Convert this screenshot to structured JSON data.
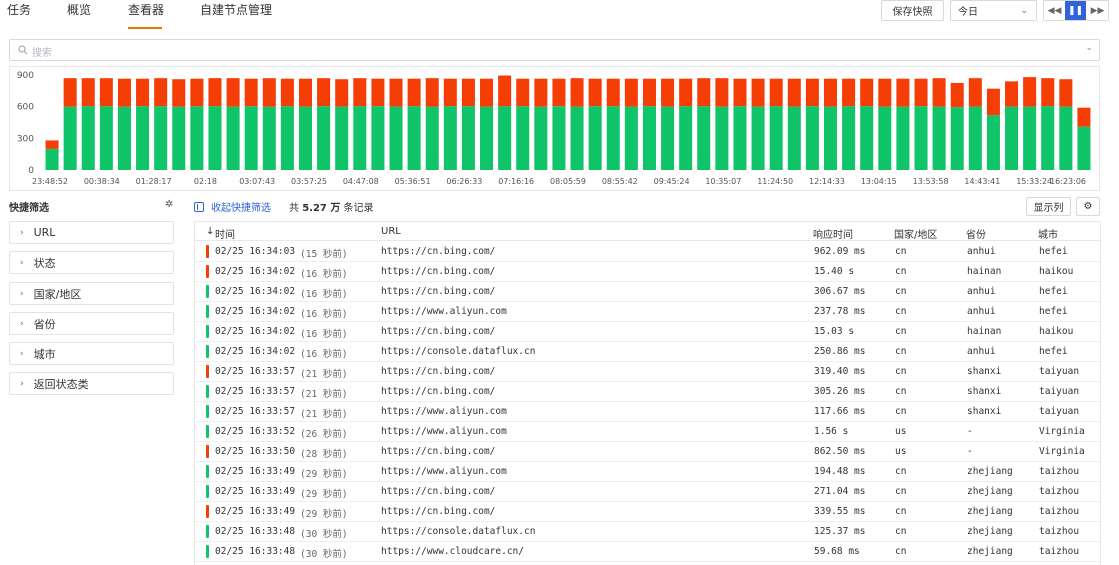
{
  "tabs": [
    {
      "label": "任务",
      "active": false
    },
    {
      "label": "概览",
      "active": false
    },
    {
      "label": "查看器",
      "active": true
    },
    {
      "label": "自建节点管理",
      "active": false
    }
  ],
  "toolbar": {
    "save_snapshot_label": "保存快照",
    "time_range_value": "今日",
    "play_controls": [
      "rewind-icon",
      "pause-icon",
      "forward-icon"
    ]
  },
  "search": {
    "placeholder": "搜索"
  },
  "colors": {
    "success": "#10c469",
    "error": "#f53e06",
    "accent": "#2f63d7",
    "tab_underline": "#e8750d"
  },
  "chart_data": {
    "type": "bar",
    "stacked": true,
    "ylim": [
      0,
      900
    ],
    "y_ticks": [
      "0",
      "300",
      "600",
      "900"
    ],
    "x_tick_labels": [
      "23:48:52",
      "00:38:34",
      "01:28:17",
      "02:18",
      "03:07:43",
      "03:57:25",
      "04:47:08",
      "05:36:51",
      "06:26:33",
      "07:16:16",
      "08:05:59",
      "08:55:42",
      "09:45:24",
      "10:35:07",
      "11:24:50",
      "12:14:33",
      "13:04:15",
      "13:53:58",
      "14:43:41",
      "15:33:24",
      "16:23:06"
    ],
    "series": [
      {
        "color": "#10c469",
        "values": [
          200,
          600,
          605,
          605,
          600,
          605,
          605,
          600,
          605,
          605,
          600,
          605,
          600,
          605,
          600,
          605,
          600,
          605,
          605,
          600,
          605,
          600,
          605,
          605,
          600,
          605,
          605,
          600,
          605,
          600,
          605,
          605,
          600,
          605,
          600,
          605,
          605,
          600,
          605,
          600,
          605,
          600,
          605,
          600,
          605,
          605,
          600,
          600,
          605,
          600,
          595,
          600,
          520,
          600,
          600,
          605,
          600,
          410
        ]
      },
      {
        "color": "#f53e06",
        "values": [
          80,
          270,
          265,
          265,
          265,
          260,
          265,
          260,
          260,
          265,
          270,
          260,
          270,
          260,
          265,
          265,
          260,
          265,
          260,
          265,
          260,
          270,
          260,
          260,
          265,
          290,
          260,
          265,
          260,
          270,
          260,
          260,
          265,
          260,
          265,
          260,
          265,
          270,
          260,
          265,
          260,
          265,
          260,
          265,
          260,
          260,
          265,
          265,
          260,
          270,
          230,
          270,
          250,
          240,
          280,
          265,
          260,
          180
        ]
      }
    ]
  },
  "sidebar": {
    "title": "快捷筛选",
    "facets": [
      "URL",
      "状态",
      "国家/地区",
      "省份",
      "城市",
      "返回状态类"
    ]
  },
  "list": {
    "collapse_label": "收起快捷筛选",
    "count_prefix": "共",
    "count_value": "5.27 万",
    "count_suffix": "条记录",
    "show_columns_label": "显示列",
    "columns": [
      "时间",
      "URL",
      "响应时间",
      "国家/地区",
      "省份",
      "城市"
    ],
    "rows": [
      {
        "status": "error",
        "time": "02/25 16:34:03",
        "ago": "(15 秒前)",
        "url": "https://cn.bing.com/",
        "rt": "962.09 ms",
        "country": "cn",
        "province": "anhui",
        "city": "hefei"
      },
      {
        "status": "error",
        "time": "02/25 16:34:02",
        "ago": "(16 秒前)",
        "url": "https://cn.bing.com/",
        "rt": "15.40 s",
        "country": "cn",
        "province": "hainan",
        "city": "haikou"
      },
      {
        "status": "ok",
        "time": "02/25 16:34:02",
        "ago": "(16 秒前)",
        "url": "https://cn.bing.com/",
        "rt": "306.67 ms",
        "country": "cn",
        "province": "anhui",
        "city": "hefei"
      },
      {
        "status": "ok",
        "time": "02/25 16:34:02",
        "ago": "(16 秒前)",
        "url": "https://www.aliyun.com",
        "rt": "237.78 ms",
        "country": "cn",
        "province": "anhui",
        "city": "hefei"
      },
      {
        "status": "ok",
        "time": "02/25 16:34:02",
        "ago": "(16 秒前)",
        "url": "https://cn.bing.com/",
        "rt": "15.03 s",
        "country": "cn",
        "province": "hainan",
        "city": "haikou"
      },
      {
        "status": "ok",
        "time": "02/25 16:34:02",
        "ago": "(16 秒前)",
        "url": "https://console.dataflux.cn",
        "rt": "250.86 ms",
        "country": "cn",
        "province": "anhui",
        "city": "hefei"
      },
      {
        "status": "error",
        "time": "02/25 16:33:57",
        "ago": "(21 秒前)",
        "url": "https://cn.bing.com/",
        "rt": "319.40 ms",
        "country": "cn",
        "province": "shanxi",
        "city": "taiyuan"
      },
      {
        "status": "ok",
        "time": "02/25 16:33:57",
        "ago": "(21 秒前)",
        "url": "https://cn.bing.com/",
        "rt": "305.26 ms",
        "country": "cn",
        "province": "shanxi",
        "city": "taiyuan"
      },
      {
        "status": "ok",
        "time": "02/25 16:33:57",
        "ago": "(21 秒前)",
        "url": "https://www.aliyun.com",
        "rt": "117.66 ms",
        "country": "cn",
        "province": "shanxi",
        "city": "taiyuan"
      },
      {
        "status": "ok",
        "time": "02/25 16:33:52",
        "ago": "(26 秒前)",
        "url": "https://www.aliyun.com",
        "rt": "1.56 s",
        "country": "us",
        "province": "-",
        "city": "Virginia"
      },
      {
        "status": "error",
        "time": "02/25 16:33:50",
        "ago": "(28 秒前)",
        "url": "https://cn.bing.com/",
        "rt": "862.50 ms",
        "country": "us",
        "province": "-",
        "city": "Virginia"
      },
      {
        "status": "ok",
        "time": "02/25 16:33:49",
        "ago": "(29 秒前)",
        "url": "https://www.aliyun.com",
        "rt": "194.48 ms",
        "country": "cn",
        "province": "zhejiang",
        "city": "taizhou"
      },
      {
        "status": "ok",
        "time": "02/25 16:33:49",
        "ago": "(29 秒前)",
        "url": "https://cn.bing.com/",
        "rt": "271.04 ms",
        "country": "cn",
        "province": "zhejiang",
        "city": "taizhou"
      },
      {
        "status": "error",
        "time": "02/25 16:33:49",
        "ago": "(29 秒前)",
        "url": "https://cn.bing.com/",
        "rt": "339.55 ms",
        "country": "cn",
        "province": "zhejiang",
        "city": "taizhou"
      },
      {
        "status": "ok",
        "time": "02/25 16:33:48",
        "ago": "(30 秒前)",
        "url": "https://console.dataflux.cn",
        "rt": "125.37 ms",
        "country": "cn",
        "province": "zhejiang",
        "city": "taizhou"
      },
      {
        "status": "ok",
        "time": "02/25 16:33:48",
        "ago": "(30 秒前)",
        "url": "https://www.cloudcare.cn/",
        "rt": "59.68 ms",
        "country": "cn",
        "province": "zhejiang",
        "city": "taizhou"
      }
    ]
  }
}
